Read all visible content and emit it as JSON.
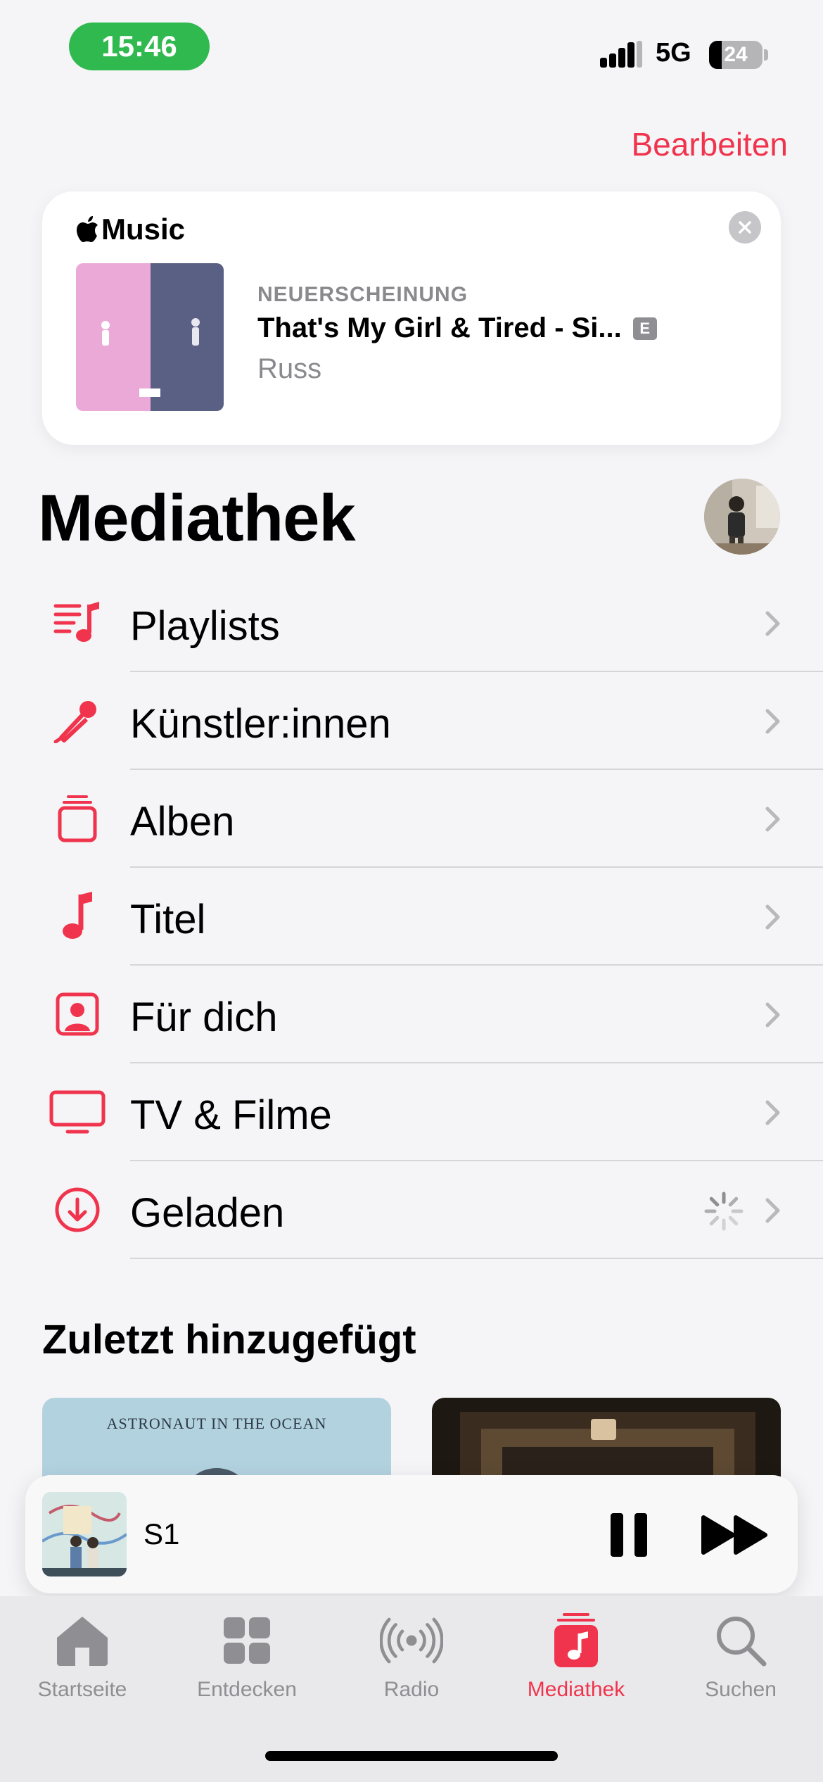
{
  "status_bar": {
    "time": "15:46",
    "network": "5G",
    "battery_level": 24,
    "battery_text": "24"
  },
  "header": {
    "edit_label": "Bearbeiten"
  },
  "banner": {
    "brand": "Music",
    "kicker": "NEUERSCHEINUNG",
    "title": "That's My Girl & Tired - Si...",
    "explicit_badge": "E",
    "artist": "Russ"
  },
  "page": {
    "title": "Mediathek"
  },
  "library": {
    "items": [
      {
        "label": "Playlists",
        "icon": "playlists-icon"
      },
      {
        "label": "Künstler:innen",
        "icon": "microphone-icon"
      },
      {
        "label": "Alben",
        "icon": "album-stack-icon"
      },
      {
        "label": "Titel",
        "icon": "music-note-icon"
      },
      {
        "label": "Für dich",
        "icon": "person-square-icon"
      },
      {
        "label": "TV & Filme",
        "icon": "tv-icon"
      },
      {
        "label": "Geladen",
        "icon": "download-circle-icon"
      }
    ]
  },
  "recent": {
    "title": "Zuletzt hinzugefügt",
    "albums": [
      {
        "label": "ASTRONAUT IN THE OCEAN"
      },
      {
        "label": ""
      }
    ]
  },
  "now_playing": {
    "title": "S1"
  },
  "tabs": [
    {
      "label": "Startseite",
      "icon": "house-icon"
    },
    {
      "label": "Entdecken",
      "icon": "grid-icon"
    },
    {
      "label": "Radio",
      "icon": "radio-waves-icon"
    },
    {
      "label": "Mediathek",
      "icon": "library-icon",
      "active": true
    },
    {
      "label": "Suchen",
      "icon": "search-icon"
    }
  ],
  "colors": {
    "accent": "#f0344d",
    "status_pill": "#30b94e",
    "secondary_text": "#8a8a8e"
  }
}
